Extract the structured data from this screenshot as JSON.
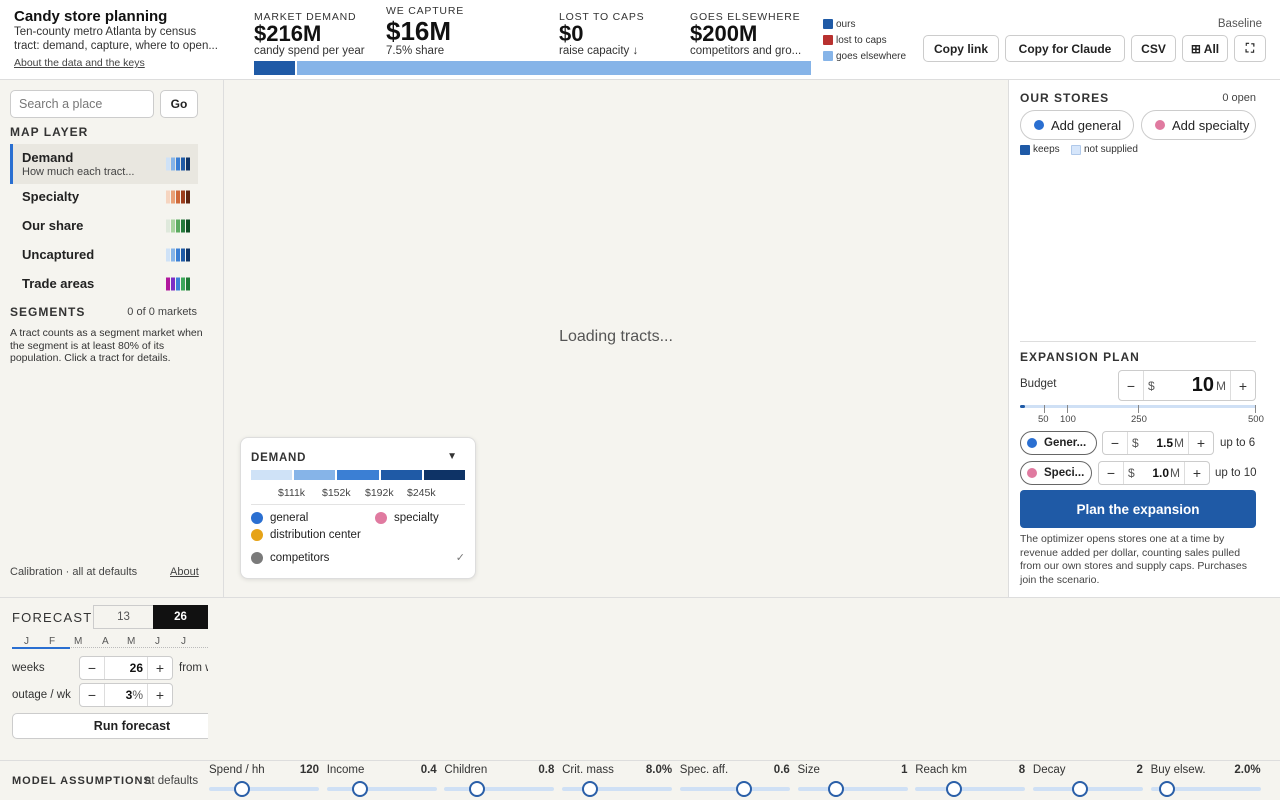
{
  "header": {
    "title": "Candy store planning",
    "subtitle_line1": "Ten-county metro Atlanta by census",
    "subtitle_line2": "tract: demand, capture, where to open...",
    "about_link": "About the data and the keys",
    "kpis": [
      {
        "label": "MARKET DEMAND",
        "value": "$216M",
        "desc": "candy spend per year"
      },
      {
        "label": "WE CAPTURE",
        "value": "$16M",
        "desc": "7.5% share"
      },
      {
        "label": "LOST TO CAPS",
        "value": "$0",
        "desc": "raise capacity ↓"
      },
      {
        "label": "GOES ELSEWHERE",
        "value": "$200M",
        "desc": "competitors and gro..."
      }
    ],
    "share_bar": {
      "ours": 16,
      "lost": 0,
      "elsewhere": 200
    },
    "legend": [
      {
        "label": "ours",
        "color": "#1f5aa6"
      },
      {
        "label": "lost to caps",
        "color": "#b8312f"
      },
      {
        "label": "goes elsewhere",
        "color": "#86b4e8"
      }
    ],
    "baseline": "Baseline",
    "buttons": {
      "copy_link": "Copy link",
      "copy_claude": "Copy for Claude",
      "csv": "CSV",
      "all": "⊞ All",
      "fullscreen": "⛶"
    }
  },
  "left": {
    "search_placeholder": "Search a place",
    "go": "Go",
    "map_layer_title": "MAP LAYER",
    "layers": [
      {
        "label": "Demand",
        "sub": "How much each tract...",
        "colors": [
          "#cfe2f7",
          "#86b4e8",
          "#3b7fd4",
          "#1f5aa6",
          "#0e3366"
        ]
      },
      {
        "label": "Specialty",
        "colors": [
          "#f6d5c0",
          "#e9a177",
          "#cf6a3a",
          "#9c3d1c",
          "#5e2410"
        ]
      },
      {
        "label": "Our share",
        "colors": [
          "#dfe9dc",
          "#a8d3a0",
          "#5dab61",
          "#267a3c",
          "#0f4d24"
        ]
      },
      {
        "label": "Uncaptured",
        "colors": [
          "#cfe2f7",
          "#86b4e8",
          "#3b7fd4",
          "#1f5aa6",
          "#0e3366"
        ]
      },
      {
        "label": "Trade areas",
        "colors": [
          "#b0179d",
          "#7b2ec6",
          "#3c7fd8",
          "#3da75a",
          "#1e7a36"
        ]
      }
    ],
    "segments_title": "SEGMENTS",
    "segments_count": "0 of 0 markets",
    "segments_note": "A tract counts as a segment market when the segment is at least 80% of its population. Click a tract for details.",
    "calibration": "Calibration · all at defaults",
    "about": "About"
  },
  "map": {
    "loading": "Loading tracts...",
    "legend_title": "DEMAND",
    "legend_toggle": "▼",
    "legend_colors": [
      "#cfe2f7",
      "#86b4e8",
      "#3b7fd4",
      "#1f5aa6",
      "#0e3366"
    ],
    "legend_ticks": [
      "$111k",
      "$152k",
      "$192k",
      "$245k"
    ],
    "store_types": [
      {
        "label": "general",
        "color": "#2a6fd1"
      },
      {
        "label": "specialty",
        "color": "#e07aa0"
      },
      {
        "label": "distribution center",
        "color": "#e6a317"
      },
      {
        "label": "competitors",
        "color": "#7a7a7a"
      }
    ],
    "competitors_check": "✓"
  },
  "right": {
    "our_stores_title": "OUR STORES",
    "open_count": "0 open",
    "add_general": "Add general",
    "add_specialty": "Add specialty",
    "keeps": "keeps",
    "not_supplied": "not supplied",
    "expansion_title": "EXPANSION PLAN",
    "budget_label": "Budget",
    "budget_currency": "$",
    "budget_value": "10",
    "budget_unit": "M",
    "budget_ticks": [
      "50",
      "100",
      "250",
      "500"
    ],
    "budget_fraction": 0.02,
    "general": {
      "label": "Gener...",
      "value": "1.5",
      "unit": "M",
      "limit": "up to 6"
    },
    "specialty": {
      "label": "Speci...",
      "value": "1.0",
      "unit": "M",
      "limit": "up to 10"
    },
    "plan_button": "Plan the expansion",
    "plan_note": "The optimizer opens stores one at a time by revenue added per dollar, counting sales pulled from our own stores and supply caps. Purchases join the scenario."
  },
  "forecast": {
    "title": "FORECAST",
    "opt1": "13",
    "opt2": "26",
    "months": [
      "J",
      "F",
      "M",
      "A",
      "M",
      "J",
      "J"
    ],
    "weeks_label": "weeks",
    "weeks_value": "26",
    "from_label": "from w",
    "outage_label": "outage / wk",
    "outage_value": "3",
    "outage_unit": "%",
    "run": "Run forecast"
  },
  "assumptions": {
    "title": "MODEL ASSUMPTIONS",
    "status": "at defaults",
    "sliders": [
      {
        "label": "Spend / hh",
        "value": "120",
        "frac": 0.3
      },
      {
        "label": "Income",
        "value": "0.4",
        "frac": 0.3
      },
      {
        "label": "Children",
        "value": "0.8",
        "frac": 0.3
      },
      {
        "label": "Crit. mass",
        "value": "8.0%",
        "frac": 0.25
      },
      {
        "label": "Spec. aff.",
        "value": "0.6",
        "frac": 0.58
      },
      {
        "label": "Size",
        "value": "1",
        "frac": 0.35
      },
      {
        "label": "Reach km",
        "value": "8",
        "frac": 0.35
      },
      {
        "label": "Decay",
        "value": "2",
        "frac": 0.43
      },
      {
        "label": "Buy elsew.",
        "value": "2.0%",
        "frac": 0.15
      }
    ]
  }
}
